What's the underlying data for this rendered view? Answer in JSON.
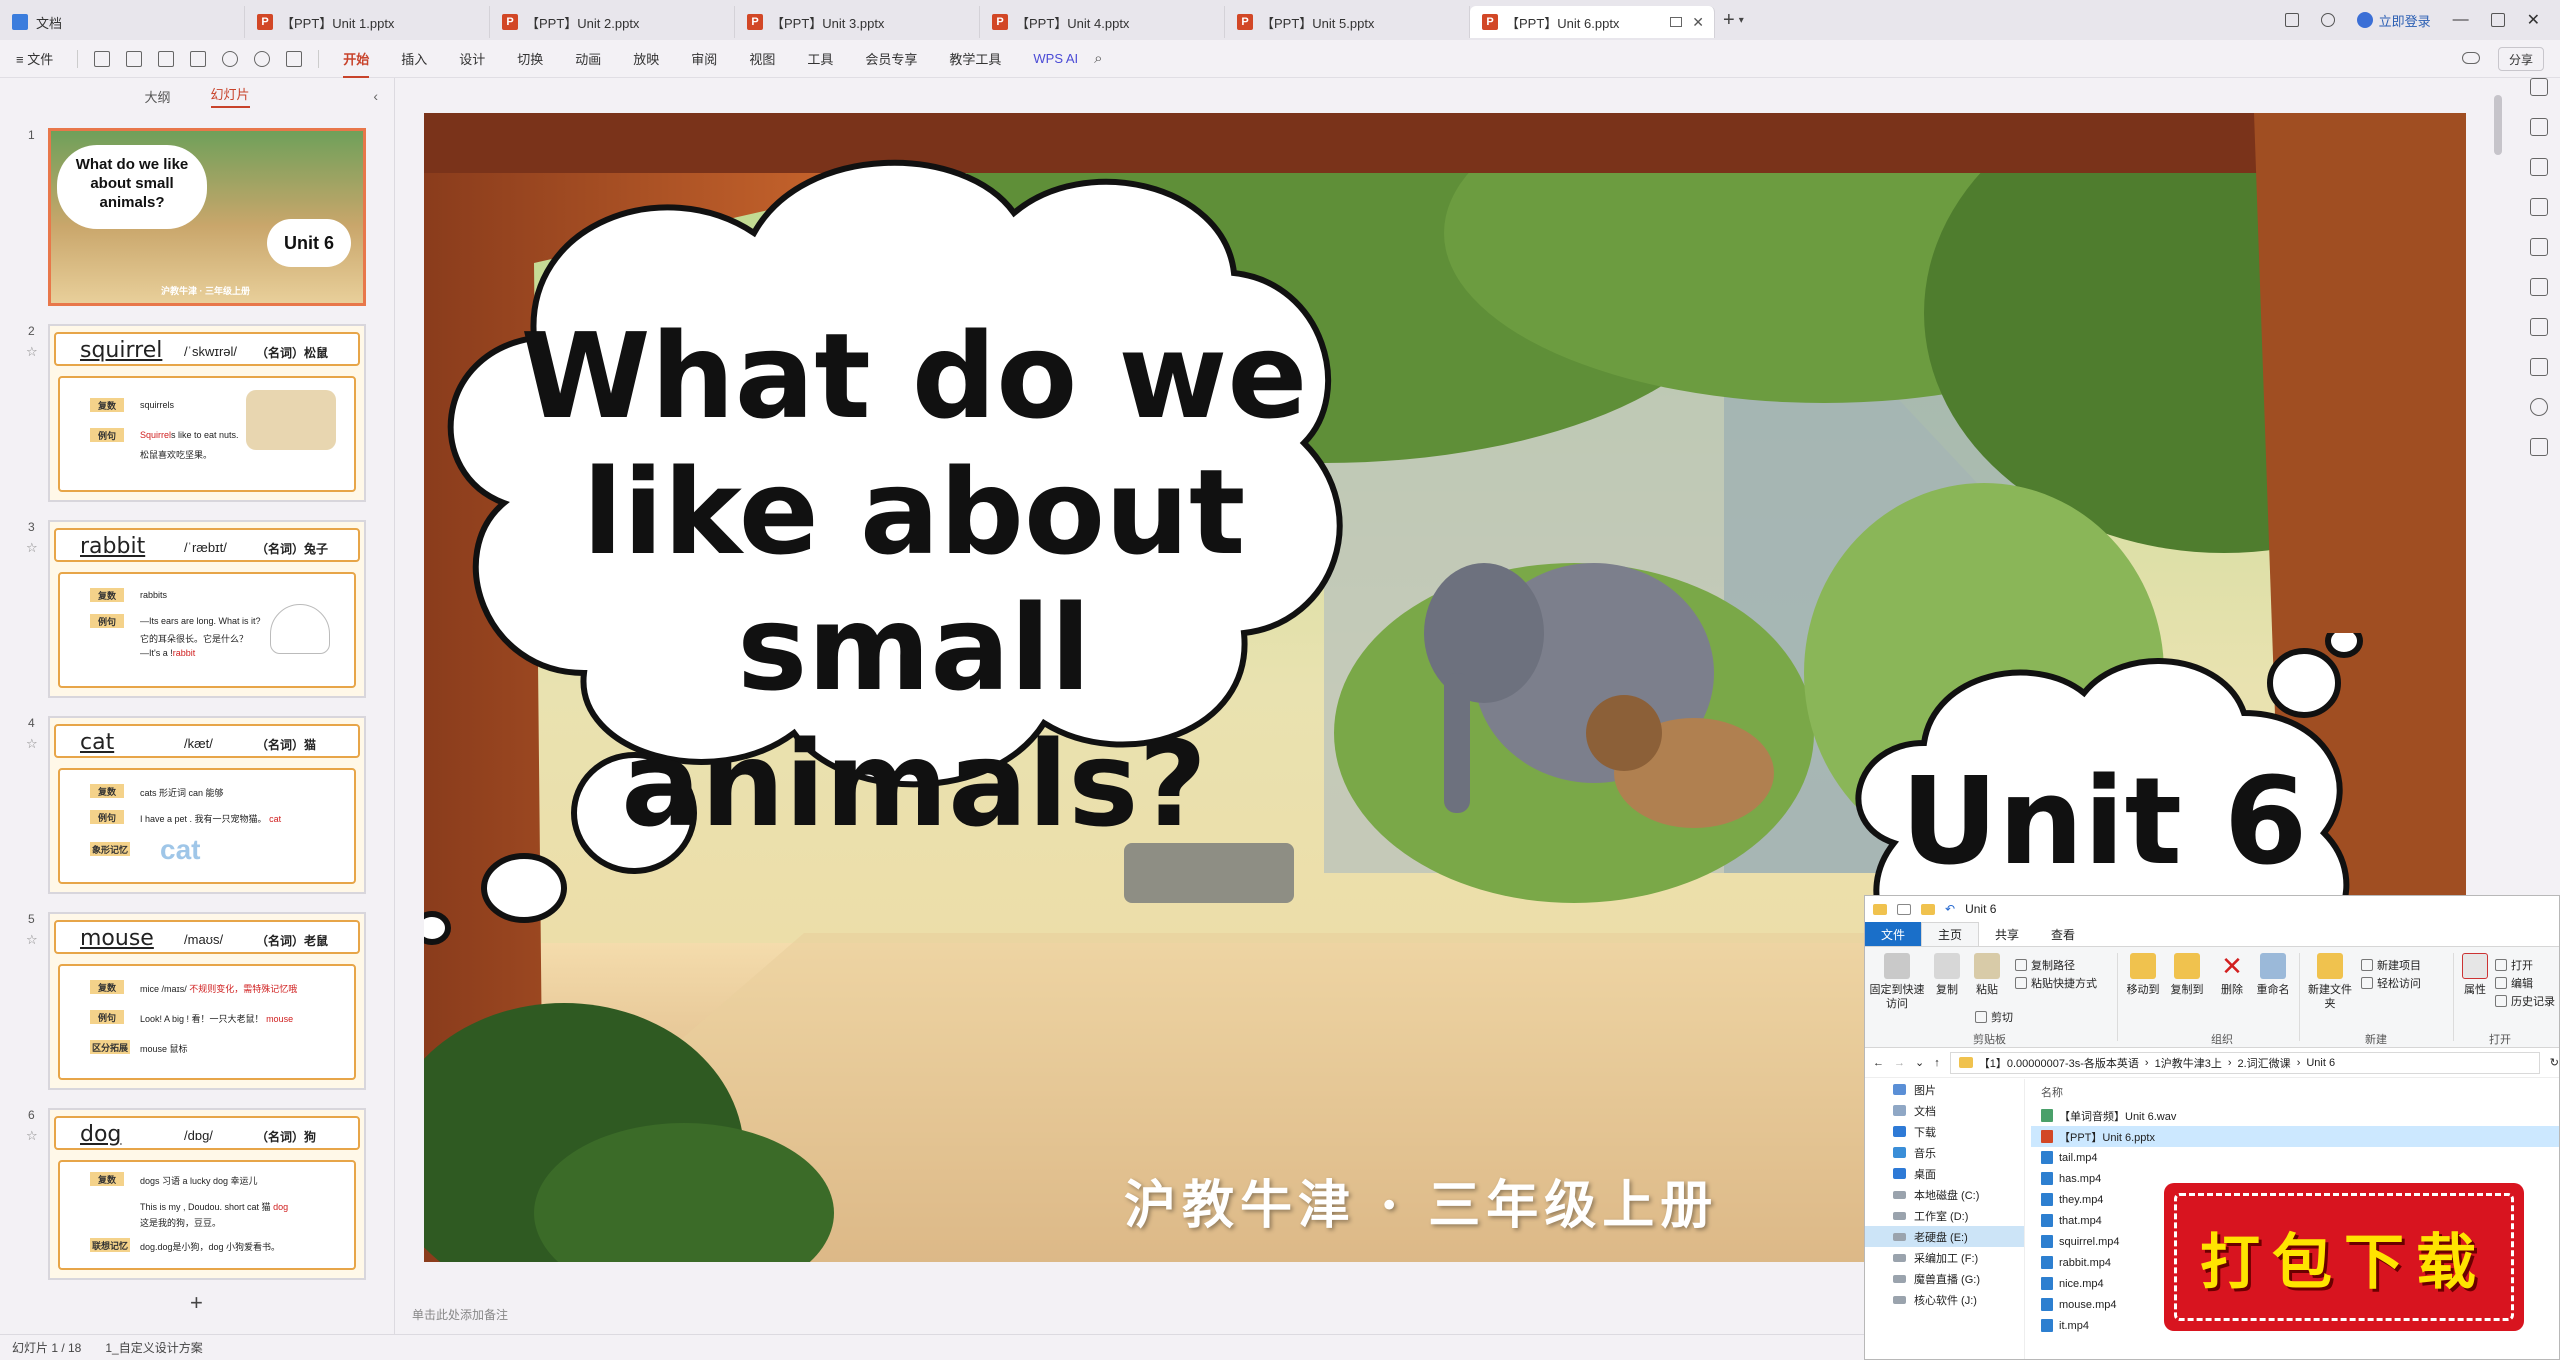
{
  "tabs": [
    {
      "label": "文档",
      "kind": "doc"
    },
    {
      "label": "【PPT】Unit 1.pptx",
      "kind": "ppt"
    },
    {
      "label": "【PPT】Unit 2.pptx",
      "kind": "ppt"
    },
    {
      "label": "【PPT】Unit 3.pptx",
      "kind": "ppt"
    },
    {
      "label": "【PPT】Unit 4.pptx",
      "kind": "ppt"
    },
    {
      "label": "【PPT】Unit 5.pptx",
      "kind": "ppt"
    },
    {
      "label": "【PPT】Unit 6.pptx",
      "kind": "ppt",
      "active": true
    }
  ],
  "tab_icon_letter": "P",
  "tab_add": "+",
  "login": "立即登录",
  "menu": {
    "file": "≡ 文件",
    "items": [
      "开始",
      "插入",
      "设计",
      "切换",
      "动画",
      "放映",
      "审阅",
      "视图",
      "工具",
      "会员专享",
      "教学工具"
    ],
    "active": "开始",
    "wps_ai": "WPS AI",
    "share": "分享"
  },
  "panel": {
    "tab_outline": "大纲",
    "tab_slides": "幻灯片",
    "collapse": "‹",
    "add": "+"
  },
  "thumbs": [
    {
      "num": "1",
      "question": "What do we like about small animals?",
      "unit": "Unit 6",
      "sub": "沪教牛津 · 三年级上册"
    },
    {
      "num": "2",
      "word": "squirrel",
      "phon": "/ˈskwɪrəl/",
      "pos": "（名词）松鼠",
      "rows": [
        {
          "tag": "复数",
          "text": "squirrels"
        },
        {
          "tag": "例句",
          "red": "Squirrel",
          "text": "s like to eat nuts."
        },
        {
          "tag": "",
          "text": "松鼠喜欢吃坚果。"
        }
      ]
    },
    {
      "num": "3",
      "word": "rabbit",
      "phon": "/ˈræbɪt/",
      "pos": "（名词）兔子",
      "rows": [
        {
          "tag": "复数",
          "text": "rabbits"
        },
        {
          "tag": "例句",
          "text": "—Its ears are long. What is it?"
        },
        {
          "tag": "",
          "text": "它的耳朵很长。它是什么？"
        },
        {
          "tag": "",
          "red": "rabbit",
          "text": "—It's a !"
        }
      ]
    },
    {
      "num": "4",
      "word": "cat",
      "phon": "/kæt/",
      "pos": "（名词）猫",
      "rows": [
        {
          "tag": "复数",
          "text": "cats   形近词  can  能够"
        },
        {
          "tag": "例句",
          "red": "cat",
          "text": "I have a pet . 我有一只宠物猫。"
        },
        {
          "tag": "象形记忆",
          "text": "cat"
        }
      ]
    },
    {
      "num": "5",
      "word": "mouse",
      "phon": "/maʊs/",
      "pos": "（名词）老鼠",
      "rows": [
        {
          "tag": "复数",
          "red": "不规则变化，需特殊记忆哦",
          "text": "mice /maɪs/ "
        },
        {
          "tag": "例句",
          "red": "mouse",
          "text": "Look! A big ! 看！一只大老鼠！"
        },
        {
          "tag": "区分拓展",
          "text": "mouse  鼠标"
        }
      ]
    },
    {
      "num": "6",
      "word": "dog",
      "phon": "/dɒg/",
      "pos": "（名词）狗",
      "rows": [
        {
          "tag": "复数",
          "text": "dogs   习语  a lucky dog  幸运儿"
        },
        {
          "tag": "",
          "red": "dog",
          "text": "This is my , Doudou.  short cat 猫"
        },
        {
          "tag": "",
          "text": "这是我的狗，豆豆。"
        },
        {
          "tag": "联想记忆",
          "text": "dog.dog是小狗，dog 小狗爱看书。"
        }
      ]
    }
  ],
  "slide": {
    "question": "What do we like about small animals?",
    "question_lines": [
      "What do we",
      "like about small",
      "animals?"
    ],
    "unit": "Unit 6",
    "subtitle": "沪教牛津 · 三年级上册"
  },
  "notes_placeholder": "单击此处添加备注",
  "status": {
    "slide_pos": "幻灯片 1 / 18",
    "design": "1_自定义设计方案"
  },
  "explorer": {
    "title": "Unit 6",
    "ribbon_tabs": [
      "文件",
      "主页",
      "共享",
      "查看"
    ],
    "active_tab": "主页",
    "pin": "固定到快速访问",
    "copy": "复制",
    "paste": "粘贴",
    "copy_path": "复制路径",
    "paste_shortcut": "粘贴快捷方式",
    "cut": "剪切",
    "group_clipboard": "剪贴板",
    "move_to": "移动到",
    "copy_to": "复制到",
    "delete": "删除",
    "rename": "重命名",
    "group_organize": "组织",
    "new_folder": "新建文件夹",
    "new_item": "新建项目",
    "easy_access": "轻松访问",
    "group_new": "新建",
    "properties": "属性",
    "open": "打开",
    "edit": "编辑",
    "history": "历史记录",
    "group_open": "打开",
    "crumbs": [
      "【1】0.00000007-3s-各版本英语",
      "1沪教牛津3上",
      "2.词汇微课",
      "Unit 6"
    ],
    "column_name": "名称",
    "nav": [
      "图片",
      "文档",
      "下载",
      "音乐",
      "桌面",
      "本地磁盘 (C:)",
      "工作室 (D:)",
      "老硬盘 (E:)",
      "采编加工 (F:)",
      "魔兽直播 (G:)",
      "核心软件 (J:)"
    ],
    "nav_selected": "老硬盘 (E:)",
    "files": [
      {
        "name": "【单词音频】Unit 6.wav",
        "type": "wav"
      },
      {
        "name": "【PPT】Unit 6.pptx",
        "type": "ppt",
        "selected": true
      },
      {
        "name": "tail.mp4",
        "type": "mp4"
      },
      {
        "name": "has.mp4",
        "type": "mp4"
      },
      {
        "name": "they.mp4",
        "type": "mp4"
      },
      {
        "name": "that.mp4",
        "type": "mp4"
      },
      {
        "name": "squirrel.mp4",
        "type": "mp4"
      },
      {
        "name": "rabbit.mp4",
        "type": "mp4"
      },
      {
        "name": "nice.mp4",
        "type": "mp4"
      },
      {
        "name": "mouse.mp4",
        "type": "mp4"
      },
      {
        "name": "it.mp4",
        "type": "mp4"
      }
    ]
  },
  "download_badge": "打包下载",
  "colors": {
    "accent": "#c8432b",
    "download_red": "#d8141f",
    "download_text": "#ffe400",
    "explorer_blue": "#1a6fc9"
  }
}
